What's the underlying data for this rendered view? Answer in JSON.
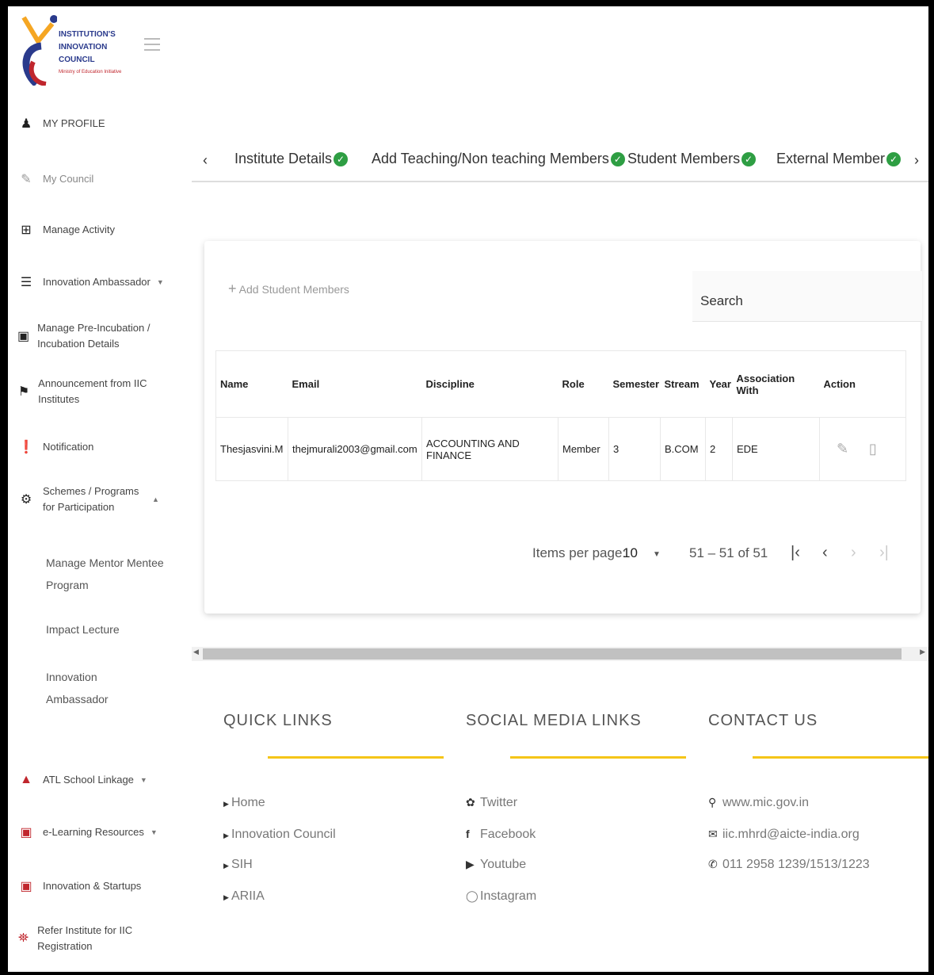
{
  "sidebar": {
    "logo_lines": [
      "INSTITUTION'S",
      "INNOVATION",
      "COUNCIL"
    ],
    "logo_sub": "Ministry of Education Initiative",
    "items": [
      {
        "label": "MY PROFILE",
        "icon": "user-icon"
      },
      {
        "label": "My Council",
        "icon": "edit-icon"
      },
      {
        "label": "Manage Activity",
        "icon": "calendar-icon"
      },
      {
        "label": "Innovation Ambassador",
        "icon": "list-icon"
      },
      {
        "label": "Manage Pre-Incubation / Incubation Details",
        "icon": "database-icon"
      },
      {
        "label": "Announcement from IIC Institutes",
        "icon": "bullhorn-icon"
      },
      {
        "label": "Notification",
        "icon": "notification-icon"
      },
      {
        "label": "Schemes / Programs for Participation",
        "icon": "gears-icon"
      }
    ],
    "sub_items": [
      "Manage Mentor Mentee Program",
      "Impact Lecture",
      "Innovation Ambassador"
    ],
    "bottom_items": [
      {
        "label": "ATL School Linkage",
        "icon": "graduation-cap-icon"
      },
      {
        "label": "e-Learning Resources",
        "icon": "chalkboard-icon"
      },
      {
        "label": "Innovation & Startups",
        "icon": "chalkboard-icon"
      },
      {
        "label": "Refer Institute for IIC Registration",
        "icon": "institution-icon"
      }
    ]
  },
  "tabs": [
    {
      "label": "Institute Details"
    },
    {
      "label": "Add Teaching/Non teaching Members"
    },
    {
      "label": "Student Members"
    },
    {
      "label": "External Member"
    }
  ],
  "card": {
    "add_label": "Add Student Members",
    "search_placeholder": "Search",
    "headers": [
      "Name",
      "Email",
      "Discipline",
      "Role",
      "Semester",
      "Stream",
      "Year",
      "Association With",
      "Action"
    ],
    "row": {
      "name": "Thesjasvini.M",
      "email": "thejmurali2003@gmail.com",
      "discipline": "ACCOUNTING AND FINANCE",
      "role": "Member",
      "semester": "3",
      "stream": "B.COM",
      "year": "2",
      "association": "EDE"
    },
    "pager": {
      "items_label": "Items per page:",
      "items_value": "10",
      "range": "51 – 51 of 51"
    }
  },
  "footer": {
    "quick_title": "QUICK LINKS",
    "quick_links": [
      "Home",
      "Innovation Council",
      "SIH",
      "ARIIA"
    ],
    "social_title": "SOCIAL MEDIA LINKS",
    "social_links": [
      "Twitter",
      "Facebook",
      "Youtube",
      "Instagram"
    ],
    "contact_title": "CONTACT US",
    "contact_links": [
      "www.mic.gov.in",
      "iic.mhrd@aicte-india.org",
      "011 2958 1239/1513/1223"
    ]
  },
  "colors": {
    "accent_green": "#2e9e43",
    "brand_red": "#c0262d",
    "footer_line": "#f5c518"
  }
}
